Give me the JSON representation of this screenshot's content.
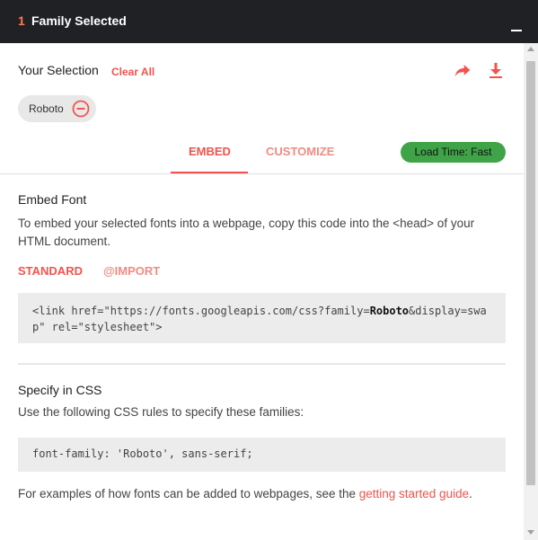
{
  "header": {
    "count": "1",
    "title": "Family Selected",
    "minimize_icon": "minimize-icon"
  },
  "selection": {
    "label": "Your Selection",
    "clear_all": "Clear All",
    "share_icon": "share-icon",
    "download_icon": "download-icon",
    "chip": {
      "label": "Roboto",
      "remove_icon": "remove-circle-icon"
    }
  },
  "tabs": {
    "embed": "EMBED",
    "customize": "CUSTOMIZE",
    "active": "EMBED"
  },
  "badge": {
    "label": "Load Time: Fast",
    "color": "#3fa447"
  },
  "embed": {
    "heading": "Embed Font",
    "description": "To embed your selected fonts into a webpage, copy this code into the <head> of your HTML document.",
    "subtabs": {
      "standard": "STANDARD",
      "import": "@IMPORT"
    },
    "code": {
      "before": "<link href=\"https://fonts.googleapis.com/css?family=",
      "bold": "Roboto",
      "after": "&display=swap\" rel=\"stylesheet\">"
    }
  },
  "css": {
    "heading": "Specify in CSS",
    "description": "Use the following CSS rules to specify these families:",
    "code": "font-family: 'Roboto', sans-serif;"
  },
  "footer": {
    "text": "For examples of how fonts can be added to webpages, see the ",
    "link": "getting started guide",
    "end": "."
  },
  "colors": {
    "accent": "#f4524d",
    "accent_light": "#f28b82",
    "topbar": "#202124",
    "code_bg": "#ececec"
  }
}
